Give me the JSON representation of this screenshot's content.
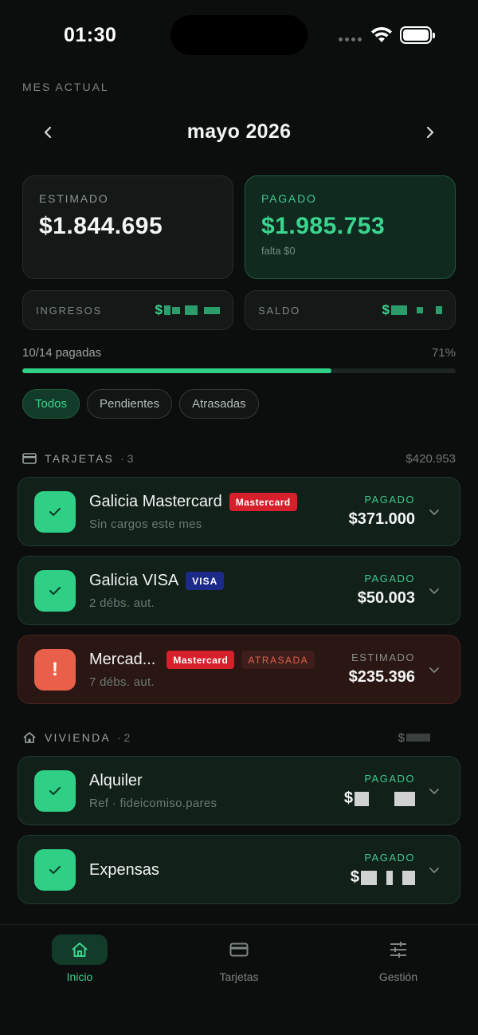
{
  "status": {
    "time": "01:30"
  },
  "header": {
    "section_label": "MES ACTUAL",
    "month": "mayo 2026"
  },
  "kpis": {
    "estimated": {
      "label": "ESTIMADO",
      "value": "$1.844.695"
    },
    "paid": {
      "label": "PAGADO",
      "value": "$1.985.753",
      "sub": "falta $0"
    }
  },
  "mini": {
    "income": {
      "label": "INGRESOS",
      "value_prefix": "$"
    },
    "balance": {
      "label": "SALDO",
      "value_prefix": "$"
    }
  },
  "progress": {
    "label": "10/14 pagadas",
    "percent_label": "71%",
    "fraction": 0.714
  },
  "filters": [
    {
      "label": "Todos",
      "active": true
    },
    {
      "label": "Pendientes",
      "active": false
    },
    {
      "label": "Atrasadas",
      "active": false
    }
  ],
  "groups": [
    {
      "title": "TARJETAS",
      "count": "· 3",
      "total": "$420.953",
      "icon": "credit-card-icon",
      "items": [
        {
          "name": "Galicia Mastercard",
          "badge": "Mastercard",
          "sub": "Sin cargos este mes",
          "status": "PAGADO",
          "amount": "$371.000"
        },
        {
          "name": "Galicia VISA",
          "badge": "VISA",
          "sub": "2 débs. aut.",
          "status": "PAGADO",
          "amount": "$50.003"
        },
        {
          "name": "Mercad...",
          "badge": "Mastercard",
          "badge2": "ATRASADA",
          "sub": "7 débs. aut.",
          "status": "ESTIMADO",
          "amount": "$235.396"
        }
      ]
    },
    {
      "title": "VIVIENDA",
      "count": "· 2",
      "total": "$",
      "icon": "home-icon",
      "items": [
        {
          "name": "Alquiler",
          "sub": "Ref · fideicomiso.pares",
          "status": "PAGADO",
          "amount": "$"
        },
        {
          "name": "Expensas",
          "status": "PAGADO",
          "amount": "$"
        }
      ]
    }
  ],
  "nav": [
    {
      "label": "Inicio",
      "icon": "home-icon",
      "active": true
    },
    {
      "label": "Tarjetas",
      "icon": "credit-card-icon",
      "active": false
    },
    {
      "label": "Gestión",
      "icon": "sliders-icon",
      "active": false
    }
  ],
  "colors": {
    "accent": "#3ad58f",
    "background": "#0b0e0d",
    "danger": "#e8604a",
    "mastercard": "#d6202c",
    "visa": "#1c2a8a"
  }
}
